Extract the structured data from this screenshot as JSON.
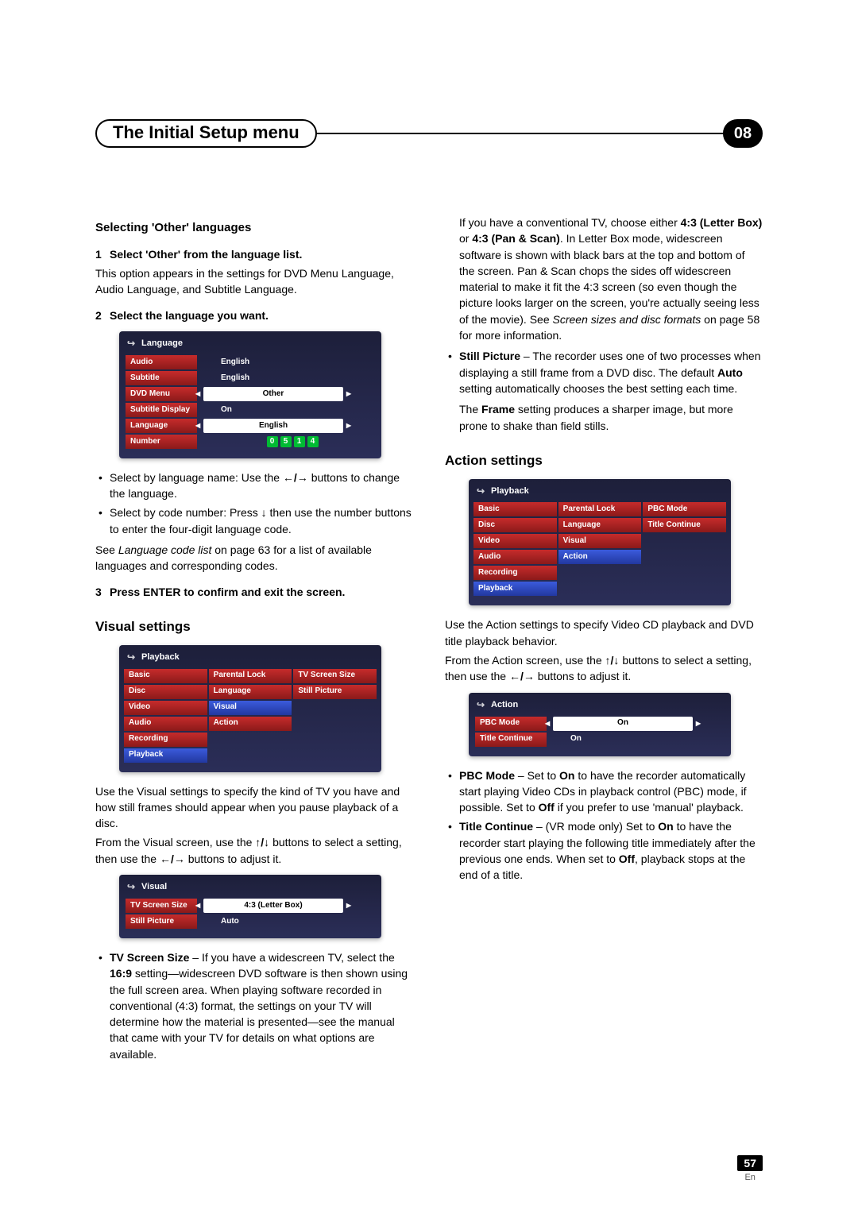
{
  "header": {
    "title": "The Initial Setup menu",
    "chapter": "08"
  },
  "left": {
    "sec1_h": "Selecting 'Other' languages",
    "step1": "Select 'Other' from the language list.",
    "step1_body": "This option appears in the settings for DVD Menu Language, Audio Language, and Subtitle Language.",
    "step2": "Select the language you want.",
    "osd_lang_title": "Language",
    "osd_lang": {
      "audio": {
        "l": "Audio",
        "v": "English"
      },
      "subtitle": {
        "l": "Subtitle",
        "v": "English"
      },
      "dvdmenu": {
        "l": "DVD Menu",
        "v": "Other"
      },
      "subdisp": {
        "l": "Subtitle Display",
        "v": "On"
      },
      "language": {
        "l": "Language",
        "v": "English"
      },
      "number": {
        "l": "Number",
        "d": [
          "0",
          "5",
          "1",
          "4"
        ]
      }
    },
    "bul1": "Select by language name: Use the ",
    "bul1b": " buttons to change the language.",
    "bul2": "Select by code number: Press ",
    "bul2b": " then use the number buttons to enter the four-digit language code.",
    "seeA": "See ",
    "seeA_i": "Language code list",
    "seeA_b": " on page 63 for a list of available languages and corresponding codes.",
    "step3": "Press ENTER to confirm and exit the screen.",
    "sec2_h": "Visual settings",
    "osd_pb_title": "Playback",
    "osd_pb_cols": {
      "c1": [
        "Basic",
        "Disc",
        "Video",
        "Audio",
        "Recording",
        "Playback"
      ],
      "c2": [
        "Parental Lock",
        "Language",
        "Visual",
        "Action",
        "",
        ""
      ],
      "c3": [
        "TV Screen Size",
        "Still Picture",
        "",
        "",
        "",
        ""
      ]
    },
    "vis_p1": "Use the Visual settings to specify the kind of TV you have and how still frames should appear when you pause playback of a disc.",
    "vis_p2a": "From the Visual screen, use the ",
    "vis_p2b": " buttons to select a setting, then use the ",
    "vis_p2c": " buttons to adjust it.",
    "osd_vis_title": "Visual",
    "osd_vis": {
      "tvsize": {
        "l": "TV Screen Size",
        "v": "4:3 (Letter Box)"
      },
      "still": {
        "l": "Still Picture",
        "v": "Auto"
      }
    },
    "tvs_a": "TV Screen Size",
    "tvs_b": " – If you have a widescreen TV, select the ",
    "tvs_c": "16:9",
    "tvs_d": " setting—widescreen DVD software is then shown using the full screen area. When playing software recorded in conventional (4:3) format, the settings on your TV will determine how the material is presented—see the manual that came with your TV for details on what options are available."
  },
  "right": {
    "p1a": "If you have a conventional TV, choose either ",
    "p1b": "4:3 (Letter Box)",
    "p1c": " or ",
    "p1d": "4:3 (Pan & Scan)",
    "p1e": ". In Letter Box mode, widescreen software is shown with black bars at the top and bottom of the screen. Pan & Scan chops the sides off widescreen material to make it fit the 4:3 screen (so even though the picture looks larger on the screen, you're actually seeing less of the movie). See ",
    "p1f": "Screen sizes and disc formats",
    "p1g": " on page 58 for more information.",
    "sp_a": "Still Picture",
    "sp_b": " – The recorder uses one of two processes when displaying a still frame from a DVD disc. The default ",
    "sp_c": "Auto",
    "sp_d": " setting automatically chooses the best setting each time.",
    "sp_e1": "The ",
    "sp_e2": "Frame",
    "sp_e3": " setting produces a sharper image, but more prone to shake than field stills.",
    "sec_h": "Action settings",
    "osd_pb_title": "Playback",
    "osd_pb_cols": {
      "c1": [
        "Basic",
        "Disc",
        "Video",
        "Audio",
        "Recording",
        "Playback"
      ],
      "c2": [
        "Parental Lock",
        "Language",
        "Visual",
        "Action",
        "",
        ""
      ],
      "c3": [
        "PBC Mode",
        "Title Continue",
        "",
        "",
        "",
        ""
      ]
    },
    "act_p1": "Use the Action settings to specify Video CD playback and DVD title playback behavior.",
    "act_p2a": "From the Action screen, use the ",
    "act_p2b": " buttons to select a setting, then use the ",
    "act_p2c": " buttons to adjust it.",
    "osd_act_title": "Action",
    "osd_act": {
      "pbc": {
        "l": "PBC Mode",
        "v": "On"
      },
      "tc": {
        "l": "Title Continue",
        "v": "On"
      }
    },
    "pbc_a": "PBC Mode",
    "pbc_b": " – Set to ",
    "pbc_c": "On",
    "pbc_d": " to have the recorder automatically start playing Video CDs in playback control (PBC) mode, if possible. Set to ",
    "pbc_e": "Off",
    "pbc_f": " if you prefer to use 'manual' playback.",
    "tc_a": "Title Continue",
    "tc_b": " – (VR mode only) Set to ",
    "tc_c": "On",
    "tc_d": " to have the recorder start playing the following title immediately after the previous one ends. When set to ",
    "tc_e": "Off",
    "tc_f": ", playback stops at the end of a title."
  },
  "footer": {
    "page": "57",
    "lang": "En"
  },
  "glyph": {
    "lr": "←/→",
    "ud": "↑/↓",
    "dn": "↓"
  }
}
